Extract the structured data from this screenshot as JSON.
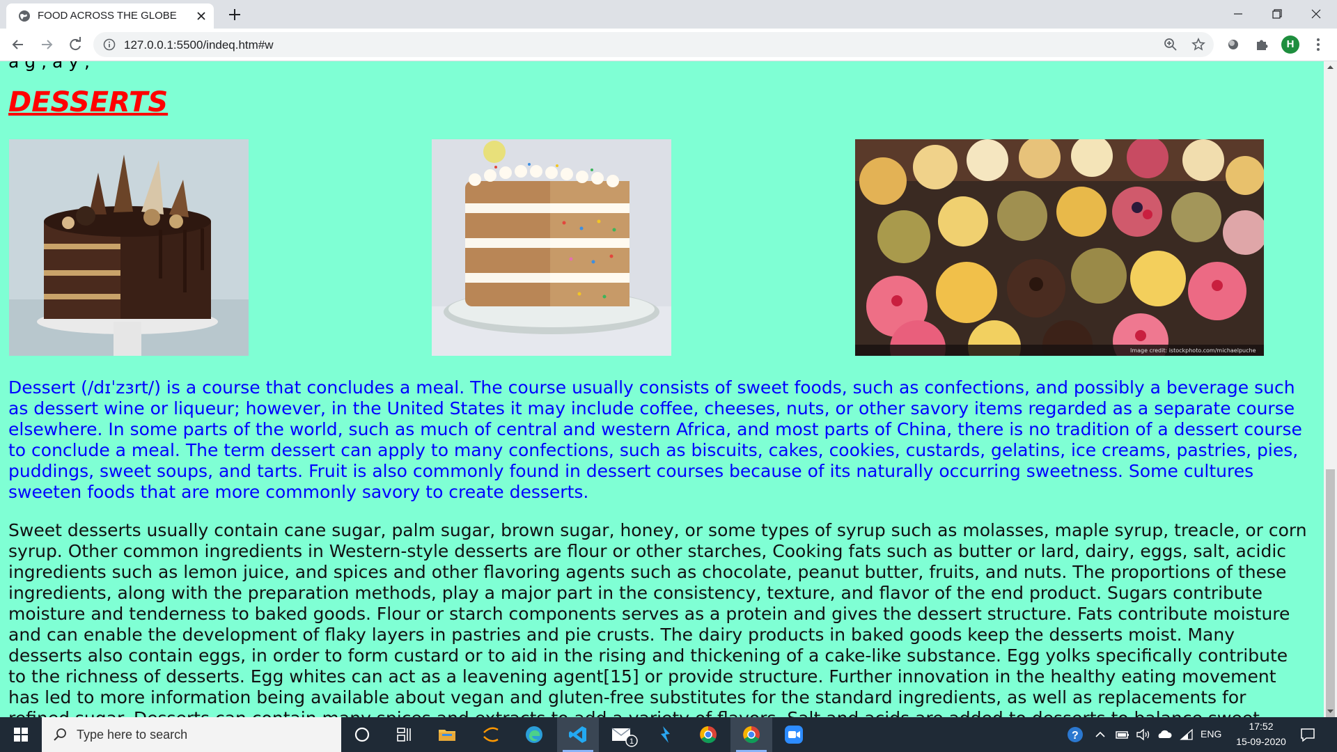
{
  "browser": {
    "tab_title": "FOOD ACROSS THE GLOBE",
    "url": "127.0.0.1:5500/indeq.htm#w",
    "profile_initial": "H"
  },
  "page": {
    "cut_line": "a g , a y ,",
    "heading": "DESSERTS",
    "images": [
      {
        "name": "chocolate-cake"
      },
      {
        "name": "funfetti-layer-cake"
      },
      {
        "name": "assorted-pastries",
        "credit": "Image credit: istockphoto.com/michaelpuche"
      }
    ],
    "paragraph_1": "Dessert (/dɪˈzɜrt/) is a course that concludes a meal. The course usually consists of sweet foods, such as confections, and possibly a beverage such as dessert wine or liqueur; however, in the United States it may include coffee, cheeses, nuts, or other savory items regarded as a separate course elsewhere. In some parts of the world, such as much of central and western Africa, and most parts of China, there is no tradition of a dessert course to conclude a meal. The term dessert can apply to many confections, such as biscuits, cakes, cookies, custards, gelatins, ice creams, pastries, pies, puddings, sweet soups, and tarts. Fruit is also commonly found in dessert courses because of its naturally occurring sweetness. Some cultures sweeten foods that are more commonly savory to create desserts.",
    "paragraph_2": "Sweet desserts usually contain cane sugar, palm sugar, brown sugar, honey, or some types of syrup such as molasses, maple syrup, treacle, or corn syrup. Other common ingredients in Western-style desserts are flour or other starches, Cooking fats such as butter or lard, dairy, eggs, salt, acidic ingredients such as lemon juice, and spices and other flavoring agents such as chocolate, peanut butter, fruits, and nuts. The proportions of these ingredients, along with the preparation methods, play a major part in the consistency, texture, and flavor of the end product. Sugars contribute moisture and tenderness to baked goods. Flour or starch components serves as a protein and gives the dessert structure. Fats contribute moisture and can enable the development of flaky layers in pastries and pie crusts. The dairy products in baked goods keep the desserts moist. Many desserts also contain eggs, in order to form custard or to aid in the rising and thickening of a cake-like substance. Egg yolks specifically contribute to the richness of desserts. Egg whites can act as a leavening agent[15] or provide structure. Further innovation in the healthy eating movement has led to more information being available about vegan and gluten-free substitutes for the standard ingredients, as well as replacements for refined sugar. Desserts can contain many spices and extracts to add a variety of flavors. Salt and acids are added to desserts to balance sweet"
  },
  "taskbar": {
    "search_placeholder": "Type here to search",
    "mail_badge": "1",
    "language": "ENG",
    "time": "17:52",
    "date": "15-09-2020"
  },
  "colors": {
    "page_background": "#7fffd4",
    "heading": "#ff0000",
    "paragraph_1": "#0000ff",
    "paragraph_2": "#111111",
    "taskbar": "#1f2a36"
  }
}
